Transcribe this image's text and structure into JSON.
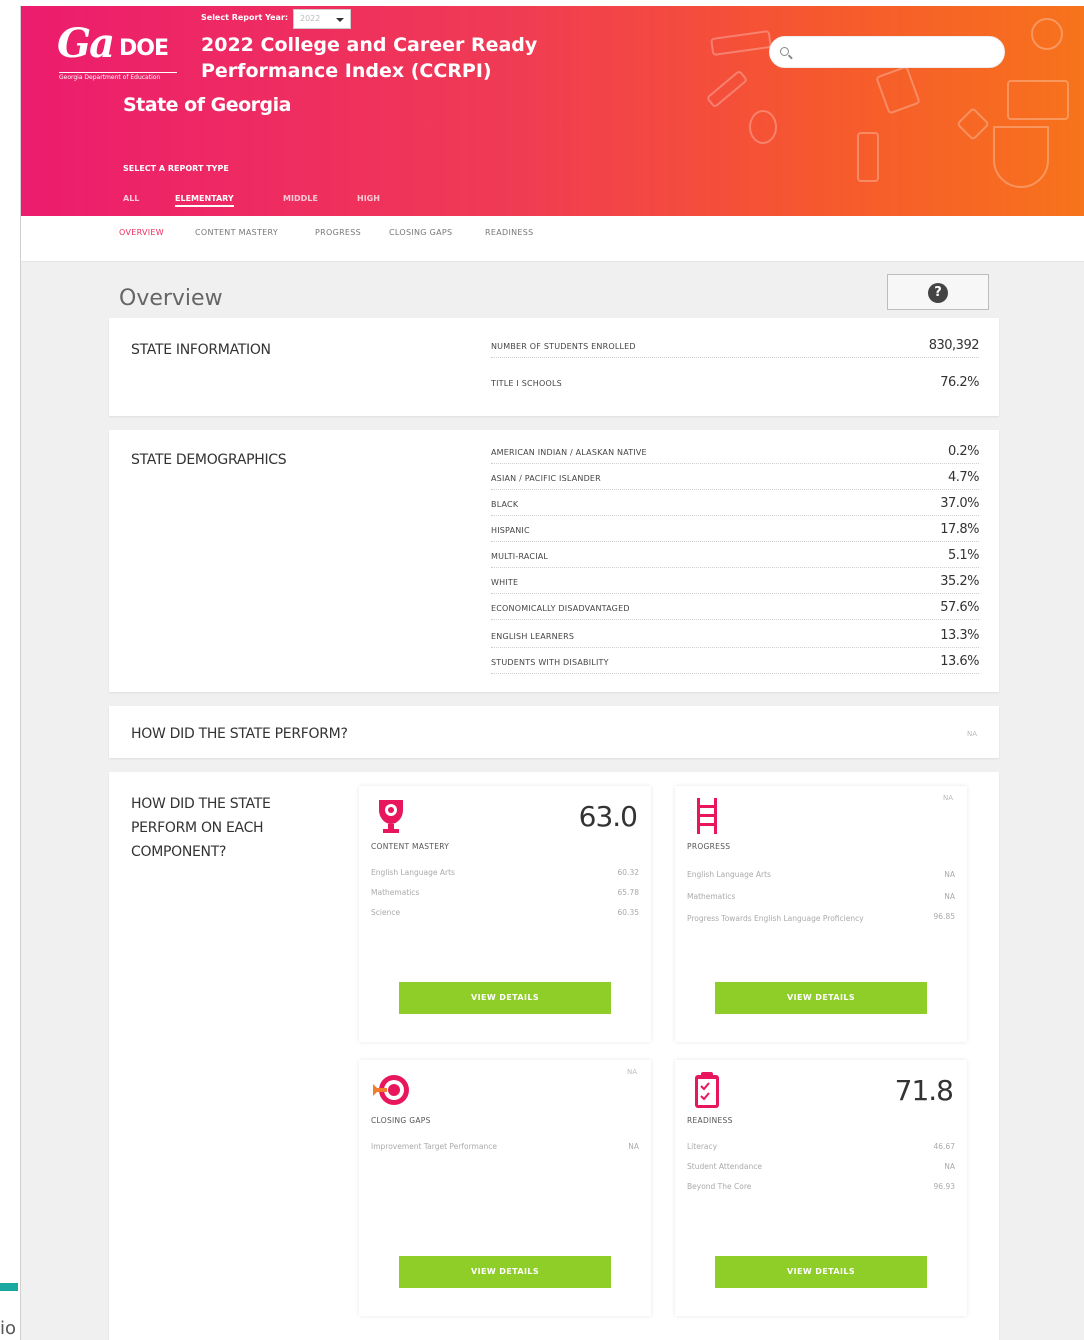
{
  "header": {
    "logo_text": "GaDOE",
    "logo_tagline": "Georgia Department of Education",
    "year_label": "Select Report Year:",
    "year_value": "2022",
    "title_line1": "2022 College and Career Ready",
    "title_line2": "Performance Index (CCRPI)",
    "state": "State of Georgia",
    "search_placeholder": "",
    "report_type_label": "SELECT A REPORT TYPE",
    "report_types": [
      "ALL",
      "ELEMENTARY",
      "MIDDLE",
      "HIGH"
    ],
    "active_report_type": "ELEMENTARY"
  },
  "subnav": {
    "items": [
      "OVERVIEW",
      "CONTENT MASTERY",
      "PROGRESS",
      "CLOSING GAPS",
      "READINESS"
    ],
    "active": "OVERVIEW"
  },
  "overview": {
    "title": "Overview",
    "help_icon": "question-circle-icon"
  },
  "state_information": {
    "title": "STATE INFORMATION",
    "rows": [
      {
        "label": "NUMBER OF STUDENTS ENROLLED",
        "value": "830,392"
      },
      {
        "label": "TITLE I SCHOOLS",
        "value": "76.2%"
      }
    ]
  },
  "state_demographics": {
    "title": "STATE DEMOGRAPHICS",
    "rows": [
      {
        "label": "AMERICAN INDIAN / ALASKAN NATIVE",
        "value": "0.2%"
      },
      {
        "label": "ASIAN / PACIFIC ISLANDER",
        "value": "4.7%"
      },
      {
        "label": "BLACK",
        "value": "37.0%"
      },
      {
        "label": "HISPANIC",
        "value": "17.8%"
      },
      {
        "label": "MULTI-RACIAL",
        "value": "5.1%"
      },
      {
        "label": "WHITE",
        "value": "35.2%"
      },
      {
        "label": "ECONOMICALLY DISADVANTAGED",
        "value": "57.6%"
      },
      {
        "label": "ENGLISH LEARNERS",
        "value": "13.3%"
      },
      {
        "label": "STUDENTS WITH DISABILITY",
        "value": "13.6%"
      }
    ]
  },
  "state_perform": {
    "title": "HOW DID THE STATE PERFORM?",
    "value": "NA"
  },
  "components": {
    "title_line1": "HOW DID THE STATE",
    "title_line2": "PERFORM ON EACH",
    "title_line3": "COMPONENT?",
    "button_label": "VIEW DETAILS",
    "accent_color": "#e8175d",
    "button_color": "#8fcd28",
    "content_mastery": {
      "name": "CONTENT MASTERY",
      "icon": "trophy-icon",
      "score": "63.0",
      "lines": [
        {
          "label": "English Language Arts",
          "value": "60.32"
        },
        {
          "label": "Mathematics",
          "value": "65.78"
        },
        {
          "label": "Science",
          "value": "60.35"
        }
      ]
    },
    "progress": {
      "name": "PROGRESS",
      "icon": "ladder-icon",
      "score": "NA",
      "lines": [
        {
          "label": "English Language Arts",
          "value": "NA"
        },
        {
          "label": "Mathematics",
          "value": "NA"
        },
        {
          "label": "Progress Towards English Language Proficiency",
          "value": "96.85"
        }
      ]
    },
    "closing_gaps": {
      "name": "CLOSING GAPS",
      "icon": "target-icon",
      "score": "NA",
      "lines": [
        {
          "label": "Improvement Target Performance",
          "value": "NA"
        }
      ]
    },
    "readiness": {
      "name": "READINESS",
      "icon": "clipboard-icon",
      "score": "71.8",
      "lines": [
        {
          "label": "Literacy",
          "value": "46.67"
        },
        {
          "label": "Student Attendance",
          "value": "NA"
        },
        {
          "label": "Beyond The Core",
          "value": "96.93"
        }
      ]
    }
  },
  "edge_text": "io"
}
